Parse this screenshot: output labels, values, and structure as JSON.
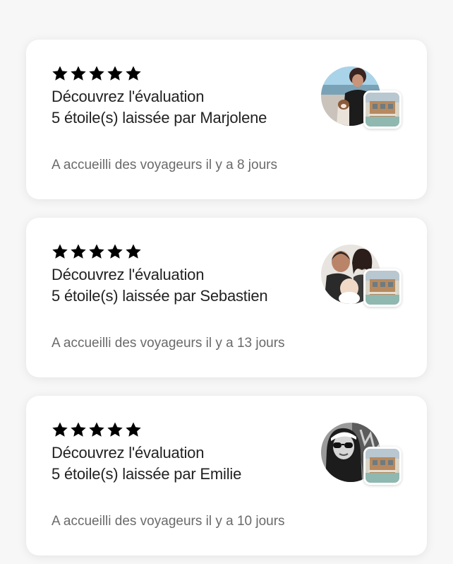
{
  "reviews": [
    {
      "rating": 5,
      "title_line1": "Découvrez l'évaluation",
      "title_line2": "5 étoile(s) laissée par Marjolene",
      "subtitle": "A accueilli des voyageurs il y a 8 jours",
      "avatar_icon": "guest-photo-with-dog",
      "listing_icon": "listing-thumbnail"
    },
    {
      "rating": 5,
      "title_line1": "Découvrez l'évaluation",
      "title_line2": "5 étoile(s) laissée par Sebastien",
      "subtitle": "A accueilli des voyageurs il y a 13 jours",
      "avatar_icon": "guest-family-photo",
      "listing_icon": "listing-thumbnail"
    },
    {
      "rating": 5,
      "title_line1": "Découvrez l'évaluation",
      "title_line2": "5 étoile(s) laissée par Emilie",
      "subtitle": "A accueilli des voyageurs il y a 10 jours",
      "avatar_icon": "guest-sunglasses-photo",
      "listing_icon": "listing-thumbnail"
    }
  ],
  "colors": {
    "star": "#000000",
    "title": "#222222",
    "subtitle": "#6a6a6a",
    "card": "#ffffff",
    "background": "#f7f7f7"
  }
}
